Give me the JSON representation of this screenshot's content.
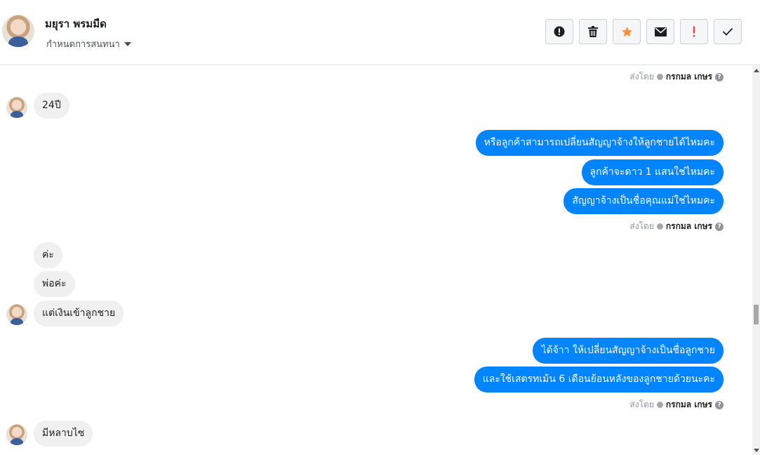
{
  "header": {
    "contact_name": "มยุรา พรมมืด",
    "assign_label": "กำหนดการสนทนา",
    "toolbar": [
      {
        "name": "mark-spam-button",
        "icon": "alert-circle-icon"
      },
      {
        "name": "delete-button",
        "icon": "trash-icon"
      },
      {
        "name": "star-button",
        "icon": "star-icon",
        "color": "#f7923b"
      },
      {
        "name": "mark-unread-button",
        "icon": "envelope-icon"
      },
      {
        "name": "follow-up-button",
        "icon": "exclamation-icon",
        "color": "#fa3e3e"
      },
      {
        "name": "mark-done-button",
        "icon": "check-icon"
      }
    ]
  },
  "sent_by": {
    "prefix": "ส่งโดย",
    "name": "กรกมล เกษร",
    "help": "?"
  },
  "messages": [
    {
      "dir": "in",
      "text": "24ปี"
    },
    {
      "dir": "out",
      "text": "หรือลูกค้าสามารถเปลี่ยนสัญญาจ้างให้ลูกชายได้ไหมคะ"
    },
    {
      "dir": "out",
      "text": "ลูกค้าจะดาว 1 แสนใช่ไหมคะ"
    },
    {
      "dir": "out",
      "text": "สัญญาจ้างเป็นชื่อคุณแม่ใช่ไหมคะ"
    },
    {
      "dir": "in",
      "text": "ค่ะ"
    },
    {
      "dir": "in",
      "text": "พ่อค่ะ"
    },
    {
      "dir": "in",
      "text": "แต่เงินเข้าลูกชาย"
    },
    {
      "dir": "out",
      "text": "ได้จ้าา ให้เปลี่ยนสัญญาจ้างเป็นชื่อลูกชาย"
    },
    {
      "dir": "out",
      "text": "และใช้เสตรทเม้น 6 เดือนย้อนหลังของลูกชายด้วยนะคะ"
    },
    {
      "dir": "in",
      "text": "มีหลาบไซ"
    }
  ],
  "colors": {
    "outgoing_bubble": "#0084ff",
    "incoming_bubble": "#f1f0f0",
    "star": "#f7923b",
    "follow_up": "#fa3e3e"
  }
}
